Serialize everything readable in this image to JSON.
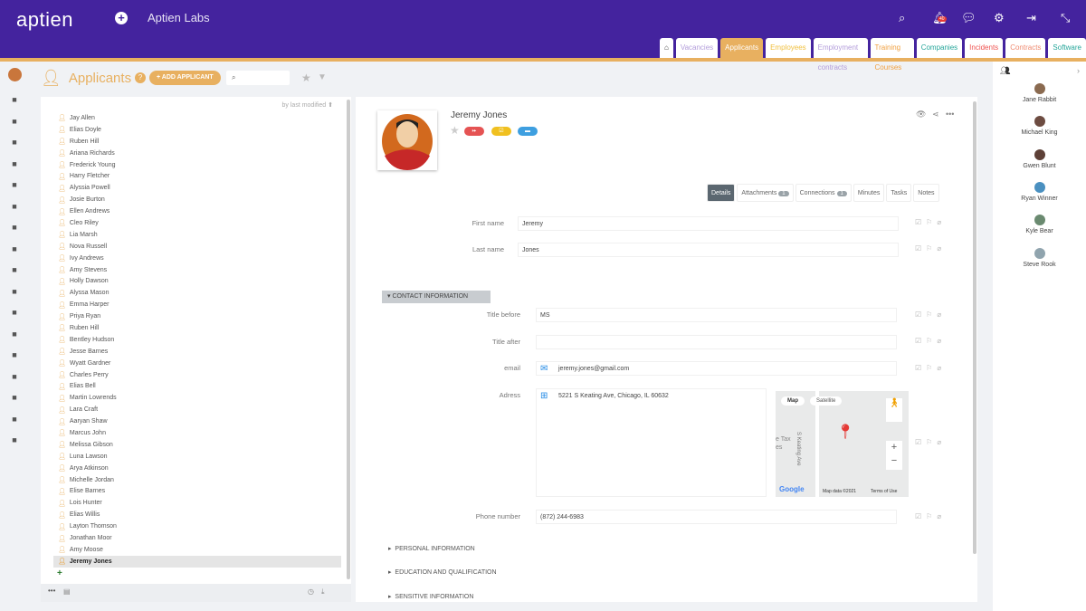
{
  "header": {
    "logo": "aptien",
    "org": "Aptien Labs",
    "notif_count": "40"
  },
  "tabs": [
    {
      "label": "Vacancies",
      "color": "#b39ddb"
    },
    {
      "label": "Applicants",
      "color": "#ffffff"
    },
    {
      "label": "Employees",
      "color": "#f0c040"
    },
    {
      "label": "Employment contracts",
      "color": "#b39ddb"
    },
    {
      "label": "Training Courses",
      "color": "#f0a040"
    },
    {
      "label": "Companies",
      "color": "#26a69a"
    },
    {
      "label": "Incidents",
      "color": "#ef5350"
    },
    {
      "label": "Contracts",
      "color": "#ef8a70"
    },
    {
      "label": "Software",
      "color": "#26a69a"
    }
  ],
  "page": {
    "title": "Applicants",
    "add_label": "+ ADD APPLICANT",
    "search_placeholder": "",
    "sort_label": "by last modified"
  },
  "applicants": [
    "Jay Allen",
    "Elias Doyle",
    "Ruben Hill",
    "Ariana Richards",
    "Frederick Young",
    "Harry Fletcher",
    "Alyssia Powell",
    "Josie Burton",
    "Ellen Andrews",
    "Cleo Riley",
    "Lia Marsh",
    "Nova Russell",
    "Ivy Andrews",
    "Amy Stevens",
    "Holly Dawson",
    "Alyssa Mason",
    "Emma Harper",
    "Priya Ryan",
    "Ruben Hill",
    "Bentley Hudson",
    "Jesse Barnes",
    "Wyatt Gardner",
    "Charles Perry",
    "Elias Bell",
    "Martin Lowrends",
    "Lara Craft",
    "Aaryan Shaw",
    "Marcus John",
    "Melissa Gibson",
    "Luna Lawson",
    "Arya Atkinson",
    "Michelle Jordan",
    "Elise Barnes",
    "Lois Hunter",
    "Elias Willis",
    "Layton Thomson",
    "Jonathan Moor",
    "Amy Moose",
    "Jeremy Jones"
  ],
  "selected": "Jeremy Jones",
  "detail": {
    "name": "Jeremy Jones",
    "tabs": [
      {
        "label": "Details"
      },
      {
        "label": "Attachments",
        "count": "1"
      },
      {
        "label": "Connections",
        "count": "1"
      },
      {
        "label": "Minutes"
      },
      {
        "label": "Tasks"
      },
      {
        "label": "Notes"
      }
    ],
    "first_name_label": "First name",
    "first_name": "Jeremy",
    "last_name_label": "Last name",
    "last_name": "Jones",
    "contact_section": "CONTACT INFORMATION",
    "title_before_label": "Title before",
    "title_before": "MS",
    "title_after_label": "Title after",
    "title_after": "",
    "email_label": "email",
    "email": "jeremy.jones@gmail.com",
    "address_label": "Adress",
    "address": "5221 S Keating Ave, Chicago, IL 60632",
    "phone_label": "Phone number",
    "phone": "(872) 244-6983",
    "sections": [
      "PERSONAL INFORMATION",
      "EDUCATION AND QUALIFICATION",
      "SENSITIVE INFORMATION"
    ],
    "map": {
      "map_btn": "Map",
      "sat_btn": "Satellite",
      "street": "S Keating Ave",
      "poi": "e Tax",
      "poi2": "es",
      "google": "Google",
      "data": "Map data ©2021",
      "terms": "Terms of Use"
    }
  },
  "users": [
    "Jane Rabbit",
    "Michael King",
    "Gwen Blunt",
    "Ryan Winner",
    "Kyle Bear",
    "Steve Rook"
  ]
}
